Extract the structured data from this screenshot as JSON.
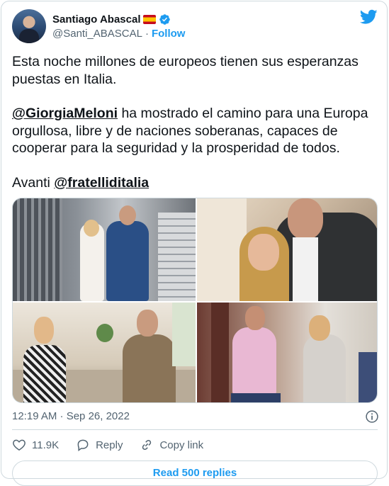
{
  "author": {
    "display_name": "Santiago Abascal",
    "handle": "@Santi_ABASCAL",
    "separator": "·",
    "follow_label": "Follow",
    "flag_icon": "spain-flag-icon",
    "verified_icon": "verified-badge-icon"
  },
  "tweet": {
    "paragraph1": "Esta noche millones de europeos tienen sus esperanzas puestas en Italia.",
    "paragraph2_mention": "@GiorgiaMeloni",
    "paragraph2_rest": " ha mostrado el camino para una Europa orgullosa, libre y de naciones soberanas, capaces de cooperar para la seguridad y la prosperidad de todos.",
    "paragraph3_prefix": "Avanti ",
    "paragraph3_mention": "@fratelliditalia"
  },
  "timestamp": "12:19 AM · Sep 26, 2022",
  "actions": {
    "like_count": "11.9K",
    "reply_label": "Reply",
    "copy_label": "Copy link"
  },
  "read_replies_label": "Read 500 replies",
  "colors": {
    "accent": "#1d9bf0",
    "text": "#0f1419",
    "secondary": "#536471",
    "border": "#cfd9de"
  }
}
